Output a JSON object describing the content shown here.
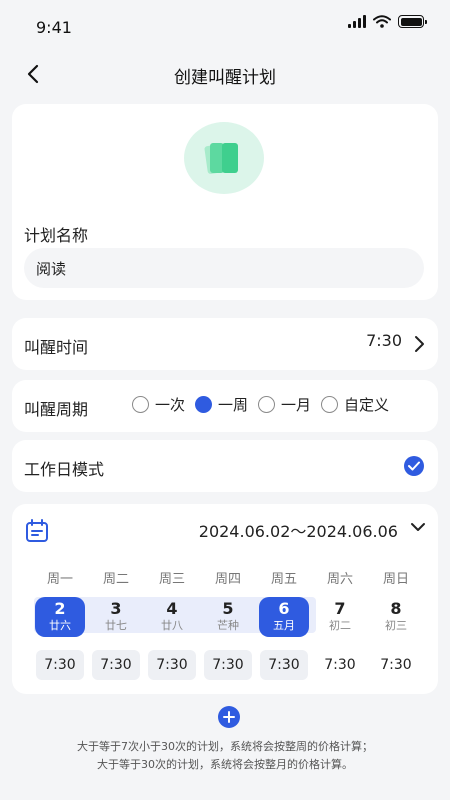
{
  "status": {
    "time": "9:41"
  },
  "nav": {
    "title": "创建叫醒计划"
  },
  "plan": {
    "name_label": "计划名称",
    "name_value": "阅读"
  },
  "wake_time": {
    "label": "叫醒时间",
    "value": "7:30"
  },
  "cycle": {
    "label": "叫醒周期",
    "options": [
      "一次",
      "一周",
      "一月",
      "自定义"
    ],
    "selected": "一周"
  },
  "workday": {
    "label": "工作日模式",
    "checked": true
  },
  "calendar": {
    "range": "2024.06.02～2024.06.06",
    "weekdays": [
      "周一",
      "周二",
      "周三",
      "周四",
      "周五",
      "周六",
      "周日"
    ],
    "days": [
      {
        "num": "2",
        "lunar": "廿六",
        "selected": true
      },
      {
        "num": "3",
        "lunar": "廿七",
        "selected": false
      },
      {
        "num": "4",
        "lunar": "廿八",
        "selected": false
      },
      {
        "num": "5",
        "lunar": "芒种",
        "selected": false
      },
      {
        "num": "6",
        "lunar": "五月",
        "selected": true
      },
      {
        "num": "7",
        "lunar": "初二",
        "selected": false
      },
      {
        "num": "8",
        "lunar": "初三",
        "selected": false
      }
    ],
    "times": [
      "7:30",
      "7:30",
      "7:30",
      "7:30",
      "7:30",
      "7:30",
      "7:30"
    ]
  },
  "notes": [
    "大于等于7次小于30次的计划，系统将会按整周的价格计算；",
    "大于等于30次的计划，系统将会按整月的价格计算。"
  ],
  "colors": {
    "accent": "#2f5be0",
    "icon_bg": "#dcf5ea",
    "icon_green": "#3fcf8e"
  }
}
